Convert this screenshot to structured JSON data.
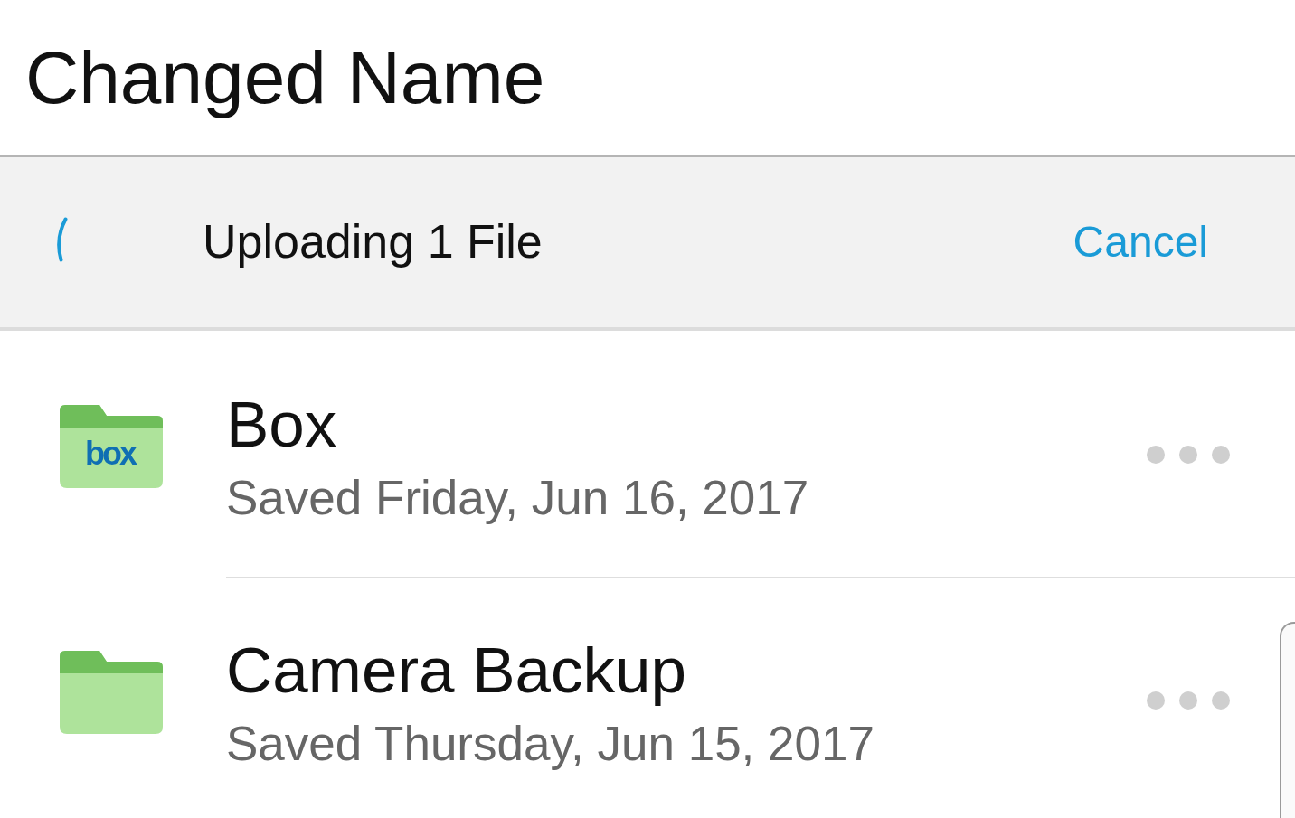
{
  "header": {
    "title": "Changed Name"
  },
  "upload_bar": {
    "status": "Uploading 1 File",
    "cancel": "Cancel"
  },
  "items": [
    {
      "name": "Box",
      "subtitle": "Saved Friday, Jun 16, 2017",
      "folder_logo": "box"
    },
    {
      "name": "Camera Backup",
      "subtitle": "Saved Thursday, Jun 15, 2017"
    }
  ]
}
